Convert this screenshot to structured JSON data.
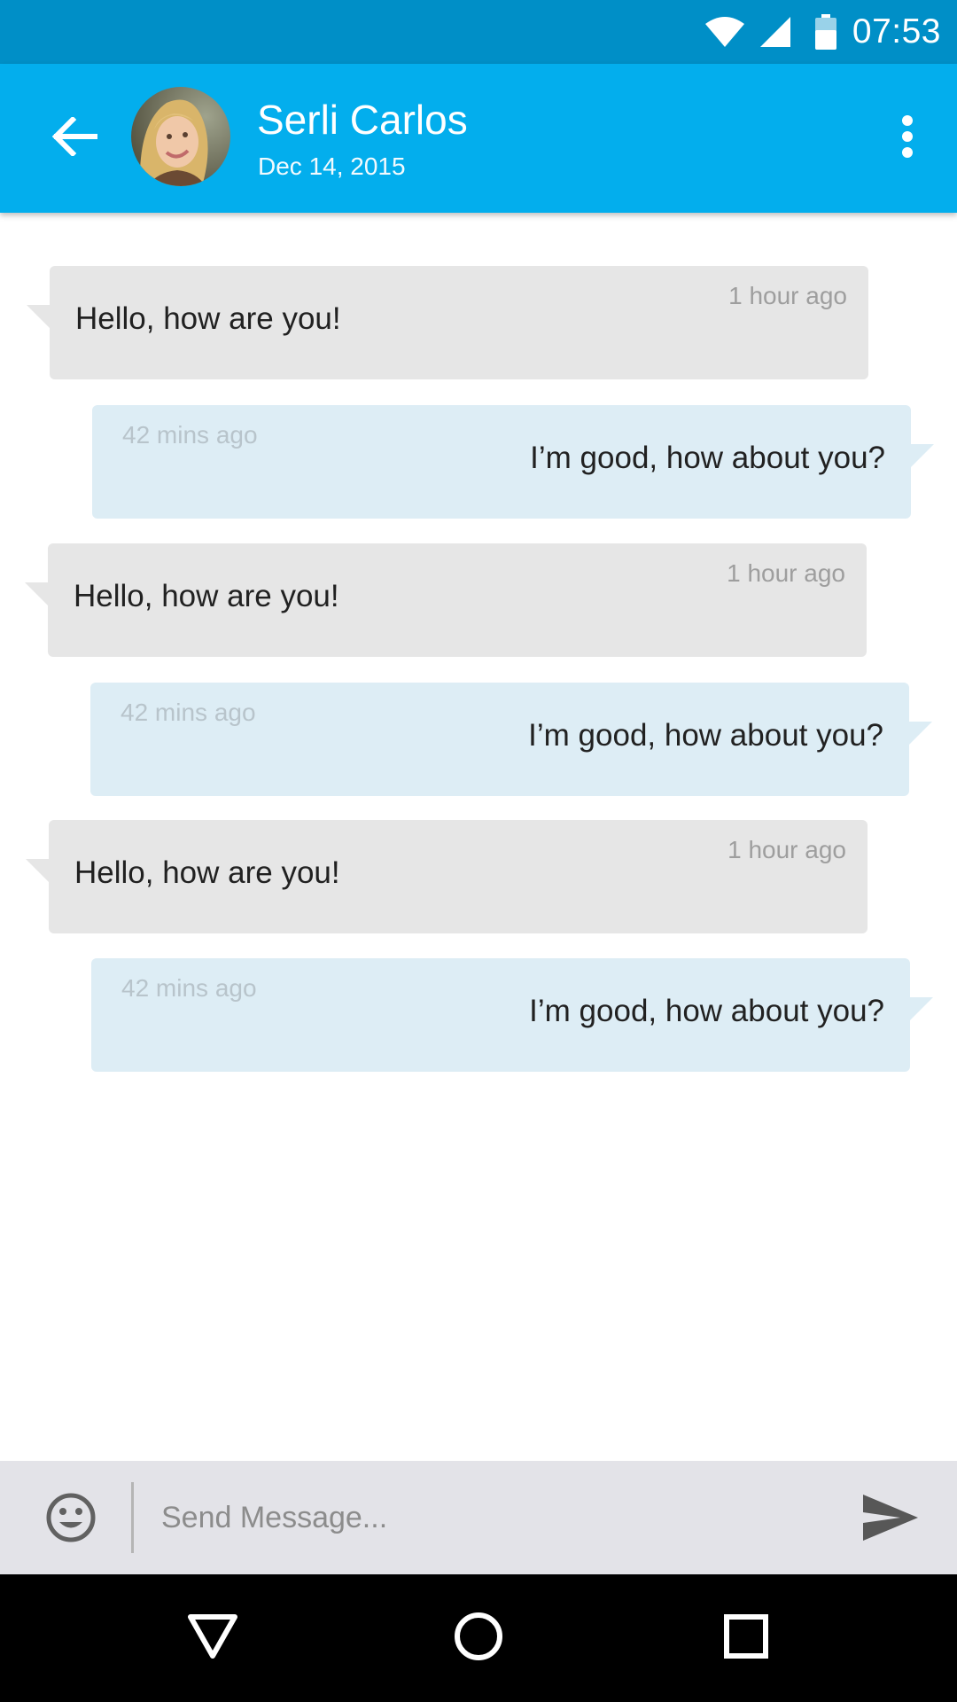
{
  "status_bar": {
    "time": "07:53",
    "icons": [
      "wifi-icon",
      "cellular-signal-icon",
      "battery-icon"
    ]
  },
  "header": {
    "contact_name": "Serli Carlos",
    "date": "Dec 14, 2015",
    "back_icon": "arrow-back-icon",
    "menu_icon": "more-vert-icon"
  },
  "messages": [
    {
      "direction": "incoming",
      "text": "Hello, how are you!",
      "time": "1 hour ago"
    },
    {
      "direction": "outgoing",
      "text": "I’m good, how about you?",
      "time": "42 mins ago"
    },
    {
      "direction": "incoming",
      "text": "Hello, how are you!",
      "time": "1 hour ago"
    },
    {
      "direction": "outgoing",
      "text": "I’m good, how about you?",
      "time": "42 mins ago"
    },
    {
      "direction": "incoming",
      "text": "Hello, how are you!",
      "time": "1 hour ago"
    },
    {
      "direction": "outgoing",
      "text": "I’m good, how about you?",
      "time": "42 mins ago"
    }
  ],
  "composer": {
    "placeholder": "Send Message...",
    "value": "",
    "emoji_icon": "emoji-icon",
    "send_icon": "send-icon"
  },
  "nav_bar": {
    "icons": [
      "nav-back-icon",
      "nav-home-icon",
      "nav-recents-icon"
    ]
  },
  "colors": {
    "status_bar": "#008fc7",
    "app_bar": "#03aeed",
    "incoming_bubble": "#e6e6e6",
    "outgoing_bubble": "#ddedf5",
    "input_bar": "#e3e3e8",
    "nav_bar": "#000000"
  }
}
